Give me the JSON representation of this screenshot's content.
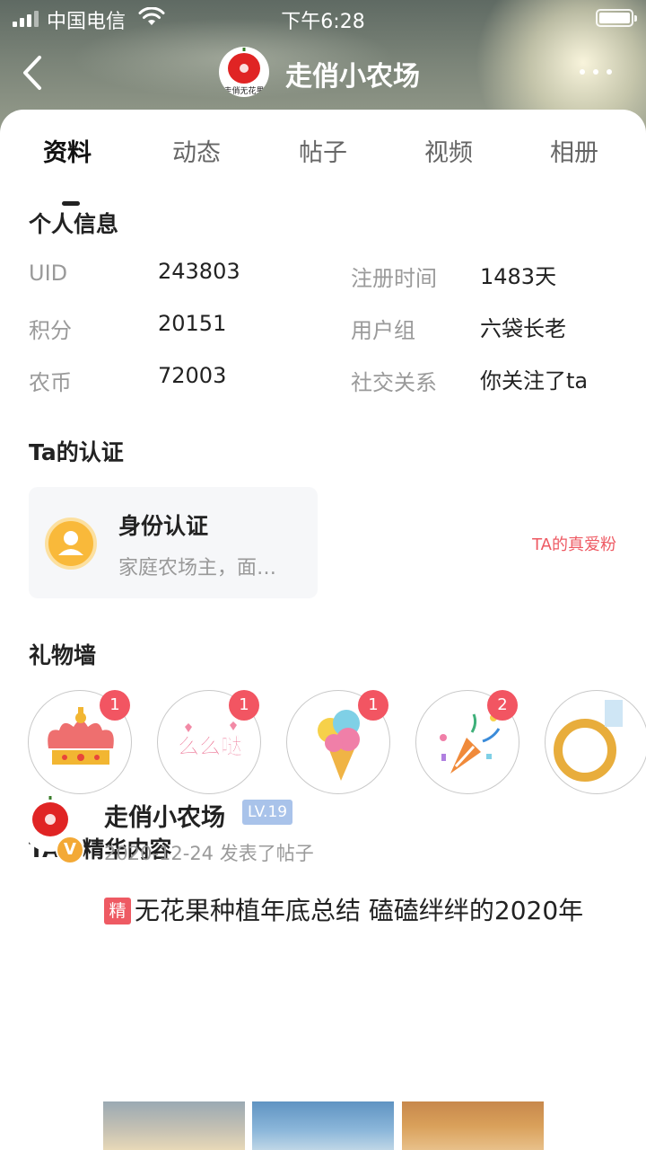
{
  "status_bar": {
    "carrier": "中国电信",
    "time": "下午6:28"
  },
  "nav": {
    "title": "走俏小农场",
    "avatar_text": "走俏无花果"
  },
  "tabs": [
    {
      "label": "资料",
      "active": true
    },
    {
      "label": "动态",
      "active": false
    },
    {
      "label": "帖子",
      "active": false
    },
    {
      "label": "视频",
      "active": false
    },
    {
      "label": "相册",
      "active": false
    }
  ],
  "personal_info": {
    "title": "个人信息",
    "rows": [
      {
        "label": "UID",
        "value": "243803"
      },
      {
        "label": "注册时间",
        "value": "1483天"
      },
      {
        "label": "积分",
        "value": "20151"
      },
      {
        "label": "用户组",
        "value": "六袋长老"
      },
      {
        "label": "农币",
        "value": "72003"
      },
      {
        "label": "社交关系",
        "value": "你关注了ta"
      }
    ]
  },
  "certification": {
    "title": "Ta的认证",
    "card_title": "身份认证",
    "card_desc": "家庭农场主，面…"
  },
  "gift_wall": {
    "title": "礼物墙",
    "link": "TA的真爱粉",
    "gifts": [
      {
        "icon": "crown-icon",
        "count": "1"
      },
      {
        "icon": "kiss-text-icon",
        "text": "么么哒",
        "count": "1"
      },
      {
        "icon": "ice-cream-icon",
        "count": "1"
      },
      {
        "icon": "party-popper-icon",
        "count": "2"
      },
      {
        "icon": "ring-icon"
      }
    ]
  },
  "featured": {
    "title": "TA的精华内容",
    "post": {
      "author": "走俏小农场",
      "level": "LV.19",
      "meta": "2020-12-24 发表了帖子",
      "tag": "精",
      "title": "无花果种植年底总结  磕磕绊绊的2020年",
      "verify_mark": "V"
    }
  },
  "colors": {
    "accent_red": "#ee5a63",
    "badge_red": "#f25562",
    "level_blue": "#a9c3ea",
    "cert_yellow": "#f9b93a"
  }
}
